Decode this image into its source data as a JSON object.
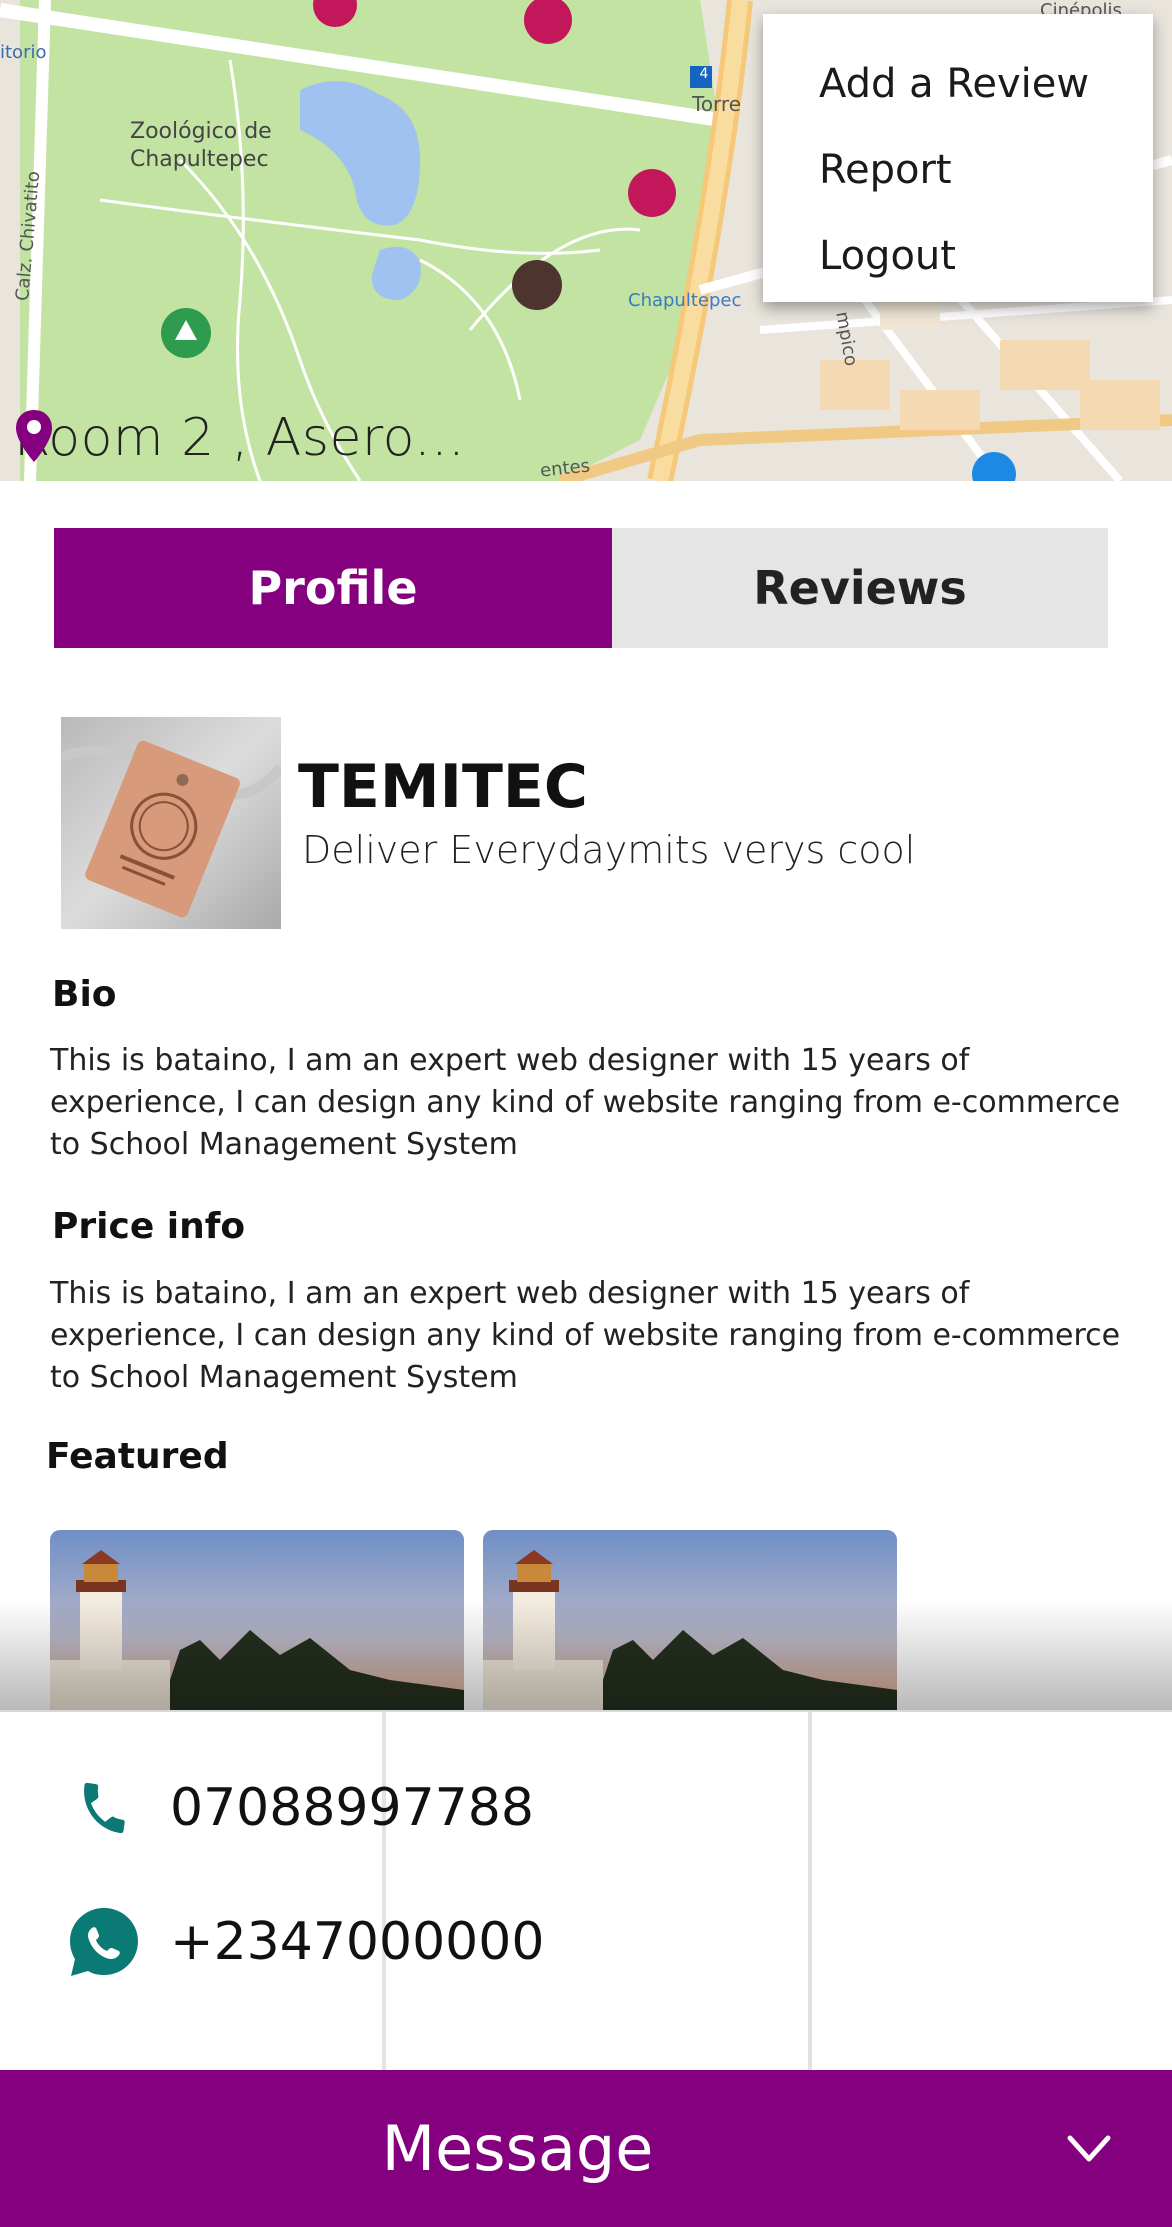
{
  "map": {
    "location_text": "Room 2 , Asero...",
    "labels": {
      "zoo": "Zoológico de\nChapultepec",
      "metro": "itorio",
      "street_left": "Calz. Chivatito",
      "chapultepec": "Chapultepec",
      "torre": "Torre",
      "olimpico": "mpico",
      "cinepolis": "Cinépolis",
      "bottom": "entes",
      "marker_4": "4"
    }
  },
  "menu": {
    "items": [
      "Add a Review",
      "Report",
      "Logout"
    ]
  },
  "tabs": {
    "profile": "Profile",
    "reviews": "Reviews"
  },
  "profile": {
    "name": "TEMITEC",
    "tagline": "Deliver Everydaymits verys cool"
  },
  "bio": {
    "title": "Bio",
    "text": "This is bataino, I am an expert web designer with 15 years of experience, I can design any kind of website ranging from e-commerce to School Management System"
  },
  "price_info": {
    "title": "Price info",
    "text": "This is bataino, I am an expert web designer with 15 years of experience, I can design any kind of website ranging from e-commerce to School Management System"
  },
  "featured": {
    "title": "Featured"
  },
  "contact": {
    "phone": "07088997788",
    "whatsapp": "+2347000000"
  },
  "message_bar": {
    "label": "Message"
  },
  "colors": {
    "brand_purple": "#85007f",
    "contact_teal": "#0b7a74",
    "tab_inactive": "#e5e5e5"
  }
}
